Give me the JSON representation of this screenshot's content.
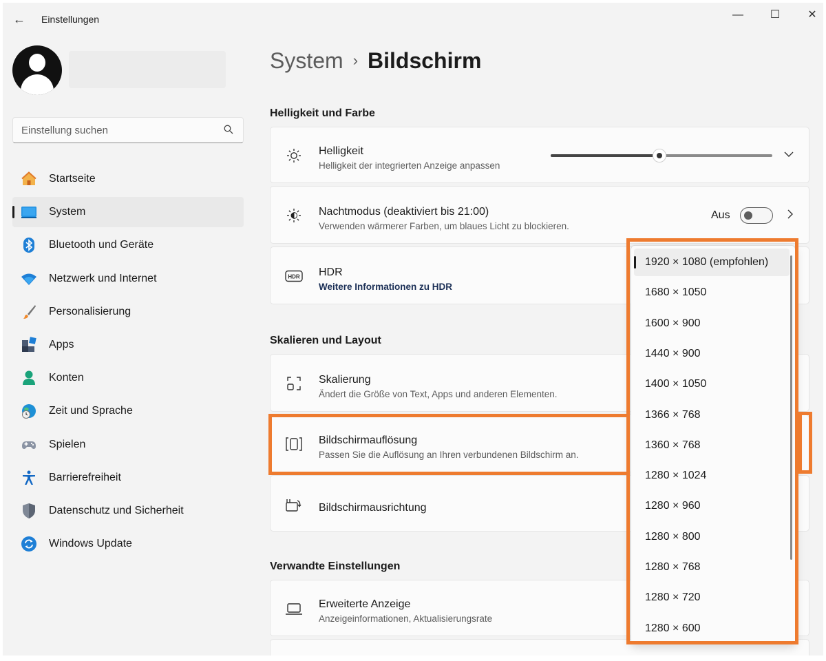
{
  "app": {
    "back_label": "←",
    "title": "Einstellungen",
    "minimize": "—",
    "maximize": "☐",
    "close": "✕"
  },
  "search": {
    "placeholder": "Einstellung suchen"
  },
  "sidebar": {
    "items": [
      {
        "label": "Startseite",
        "icon": "home-icon"
      },
      {
        "label": "System",
        "icon": "system-icon",
        "active": true
      },
      {
        "label": "Bluetooth und Geräte",
        "icon": "bluetooth-icon"
      },
      {
        "label": "Netzwerk und Internet",
        "icon": "wifi-icon"
      },
      {
        "label": "Personalisierung",
        "icon": "brush-icon"
      },
      {
        "label": "Apps",
        "icon": "apps-icon"
      },
      {
        "label": "Konten",
        "icon": "account-icon"
      },
      {
        "label": "Zeit und Sprache",
        "icon": "globe-clock-icon"
      },
      {
        "label": "Spielen",
        "icon": "gamepad-icon"
      },
      {
        "label": "Barrierefreiheit",
        "icon": "accessibility-icon"
      },
      {
        "label": "Datenschutz und Sicherheit",
        "icon": "shield-icon"
      },
      {
        "label": "Windows Update",
        "icon": "update-icon"
      }
    ]
  },
  "breadcrumb": {
    "parent": "System",
    "separator": "›",
    "current": "Bildschirm"
  },
  "sections": {
    "brightness_color": "Helligkeit und Farbe",
    "scale_layout": "Skalieren und Layout",
    "related": "Verwandte Einstellungen"
  },
  "cards": {
    "brightness": {
      "title": "Helligkeit",
      "subtitle": "Helligkeit der integrierten Anzeige anpassen",
      "value_fraction": 0.49
    },
    "night": {
      "title": "Nachtmodus (deaktiviert bis 21:00)",
      "subtitle": "Verwenden wärmerer Farben, um blaues Licht zu blockieren.",
      "toggle_label": "Aus",
      "toggle_on": false
    },
    "hdr": {
      "title": "HDR",
      "link": "Weitere Informationen zu HDR",
      "icon_text": "HDR"
    },
    "scaling": {
      "title": "Skalierung",
      "subtitle": "Ändert die Größe von Text, Apps und anderen Elementen."
    },
    "resolution": {
      "title": "Bildschirmauflösung",
      "subtitle": "Passen Sie die Auflösung an Ihren verbundenen Bildschirm an."
    },
    "orientation": {
      "title": "Bildschirmausrichtung"
    },
    "advanced": {
      "title": "Erweiterte Anzeige",
      "subtitle": "Anzeigeinformationen, Aktualisierungsrate"
    }
  },
  "resolution_dropdown": {
    "selected_index": 0,
    "options": [
      "1920 × 1080 (empfohlen)",
      "1680 × 1050",
      "1600 × 900",
      "1440 × 900",
      "1400 × 1050",
      "1366 × 768",
      "1360 × 768",
      "1280 × 1024",
      "1280 × 960",
      "1280 × 800",
      "1280 × 768",
      "1280 × 720",
      "1280 × 600"
    ]
  },
  "colors": {
    "highlight": "#ee7b2f",
    "accent": "#0067c0"
  }
}
